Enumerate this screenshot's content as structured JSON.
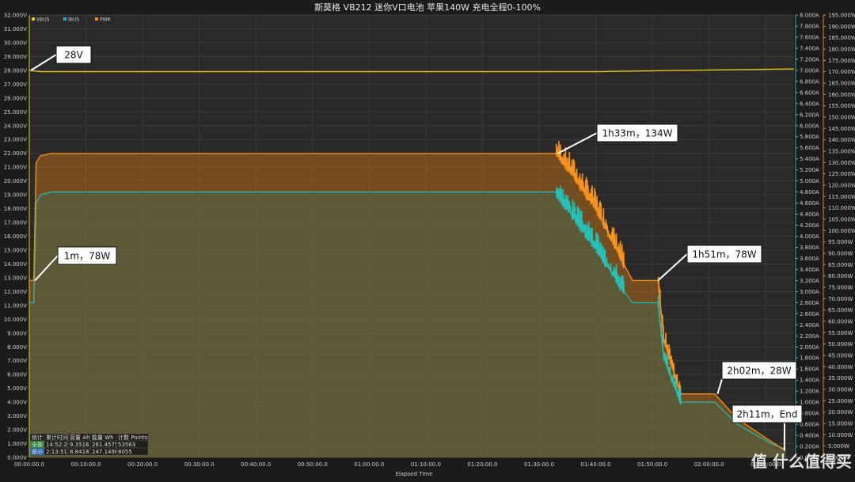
{
  "chart_data": {
    "type": "line",
    "title": "斯莫格 VB212 迷你V口电池 苹果140W 充电全程0-100%",
    "xlabel": "Elapsed Time",
    "x_ticks": [
      "00:00:00.0",
      "00:10:00.0",
      "00:20:00.0",
      "00:30:00.0",
      "00:40:00.0",
      "00:50:00.0",
      "01:00:00.0",
      "01:10:00.0",
      "01:20:00.0",
      "01:30:00.0",
      "01:40:00.0",
      "01:50:00.0",
      "02:00:00.0",
      "02:10:00.0"
    ],
    "x_range_minutes": [
      0,
      135
    ],
    "left_axis": {
      "name": "VBUS",
      "unit": "V",
      "range": [
        0,
        32
      ],
      "step": 1,
      "color": "#e8c51a"
    },
    "right_axis_1": {
      "name": "IBUS",
      "unit": "A",
      "range": [
        0,
        8
      ],
      "step": 0.2,
      "color": "#1fb7b0"
    },
    "right_axis_2": {
      "name": "PWR",
      "unit": "W",
      "range": [
        0,
        195
      ],
      "step": 5,
      "color": "#f28c14"
    },
    "legend": [
      "VBUS",
      "IBUS",
      "PWR"
    ],
    "legend_position": "top-left",
    "grid": true,
    "series": [
      {
        "name": "VBUS",
        "axis": "left",
        "x_minutes": [
          0,
          2,
          100,
          115,
          135
        ],
        "values": [
          28.0,
          27.9,
          27.9,
          28.0,
          28.1
        ]
      },
      {
        "name": "IBUS",
        "axis": "right_1",
        "x_minutes": [
          0,
          0.8,
          1.2,
          2,
          4,
          93,
          95,
          100,
          105,
          106.5,
          111,
          112,
          115,
          121,
          125,
          131,
          133.5
        ],
        "values": [
          2.8,
          2.8,
          4.6,
          4.75,
          4.8,
          4.8,
          4.5,
          3.8,
          3.0,
          2.8,
          2.8,
          1.8,
          1.0,
          1.0,
          0.6,
          0.25,
          0.15
        ]
      },
      {
        "name": "PWR",
        "axis": "right_2",
        "x_minutes": [
          0,
          0.8,
          1.2,
          2,
          4,
          93,
          95,
          100,
          105,
          106.5,
          111,
          112,
          115,
          120,
          121,
          125,
          131,
          133.5
        ],
        "values": [
          78,
          78,
          130,
          133,
          134,
          134,
          128,
          110,
          85,
          78,
          78,
          52,
          28,
          28,
          28,
          17,
          7,
          3
        ]
      }
    ],
    "annotations": [
      "28V",
      "1m，78W",
      "1h33m，134W",
      "1h51m，78W",
      "2h02m，28W",
      "2h11m，End"
    ],
    "stats_table": {
      "headers": [
        "统计",
        "累计时间",
        "容量 Ah",
        "能量 Wh",
        "计数 Points"
      ],
      "rows": [
        [
          "全部",
          "14:52:20",
          "9.3516",
          "261.4575",
          "53563"
        ],
        [
          "部分",
          "2:13:51",
          "8.8418",
          "247.1498",
          "8055"
        ]
      ]
    }
  },
  "watermark": "值 什么值得买"
}
